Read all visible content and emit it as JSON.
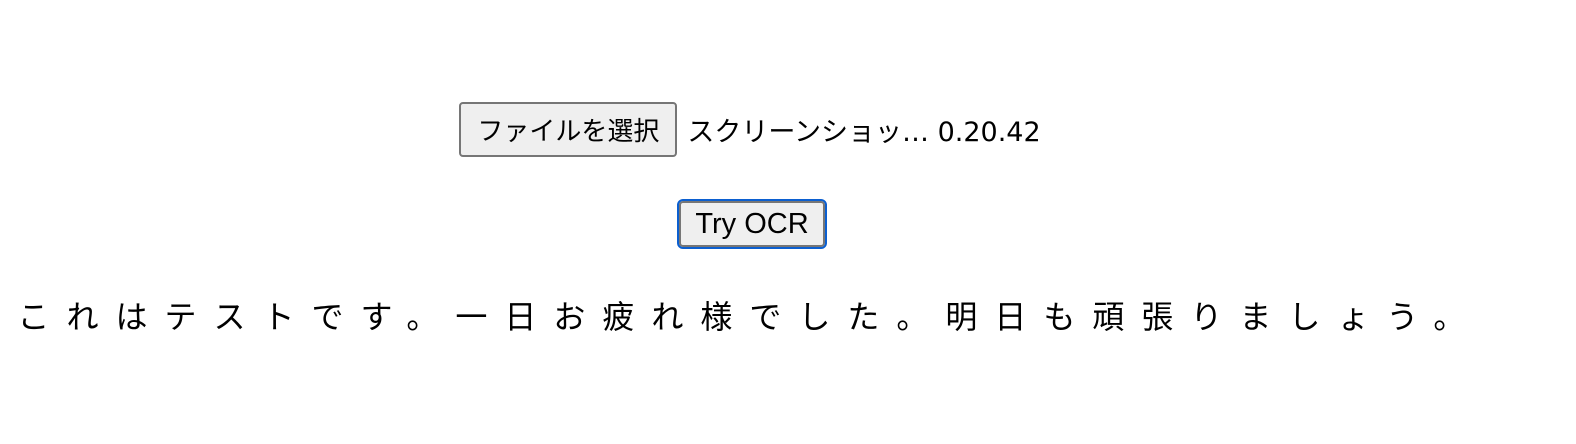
{
  "file_input": {
    "button_label": "ファイルを選択",
    "file_name": "スクリーンショッ… 0.20.42"
  },
  "ocr": {
    "button_label": "Try OCR"
  },
  "result": {
    "text": "これはテストです。一日お疲れ様でした。明日も頑張りましょう。"
  },
  "colors": {
    "focus_ring": "#0b5fd0",
    "button_bg": "#efefef",
    "button_border": "#767676"
  }
}
